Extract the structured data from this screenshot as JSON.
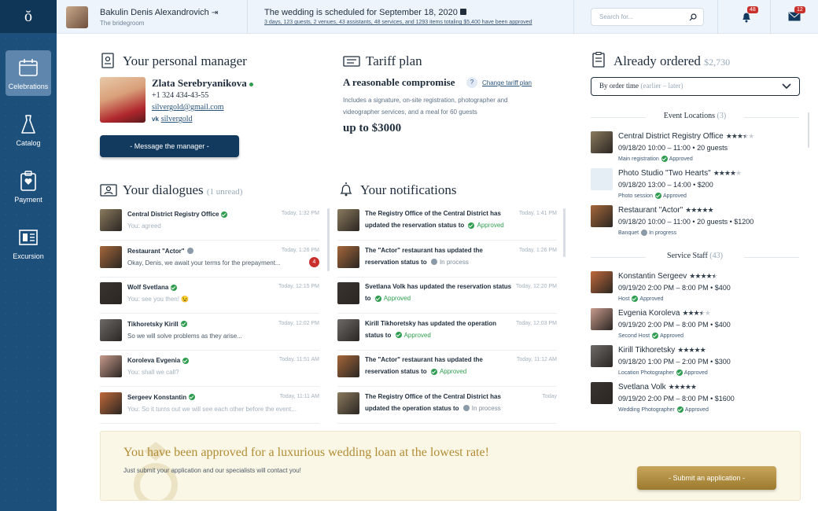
{
  "sidebar": {
    "logo": "ŏ",
    "items": [
      {
        "label": "Celebrations",
        "active": true
      },
      {
        "label": "Catalog"
      },
      {
        "label": "Payment"
      },
      {
        "label": "Excursion"
      }
    ]
  },
  "topbar": {
    "user_name": "Bakulin Denis Alexandrovich",
    "user_role": "The bridegroom",
    "wedding_title": "The wedding is scheduled for September 18, 2020",
    "wedding_summary": "3 days, 123 guests, 2 venues, 43 assistants, 48 services, and 1293 items totaling $5,400 have been approved",
    "search_placeholder": "Search for...",
    "notifications_count": "48",
    "messages_count": "12"
  },
  "manager": {
    "title": "Your personal manager",
    "name": "Zlata Serebryanikova",
    "phone": "+1 324 434-43-55",
    "email": "silvergold@gmail.com",
    "vk": "silvergold",
    "button": "- Message the manager  -"
  },
  "tariff": {
    "title": "Tariff plan",
    "name": "A reasonable compromise",
    "help": "?",
    "change": "Change tariff plan",
    "desc": "Includes a signature, on-site registration, photographer and videographer services, and a meal for 60 guests",
    "price": "up to $3000"
  },
  "dialogues": {
    "title": "Your dialogues",
    "unread": "(1 unread)",
    "items": [
      {
        "name": "Central District Registry Office",
        "msg": "You: agreed",
        "time": "Today, 1:32 PM",
        "verified": true,
        "reply": true,
        "thumb": "#8b7a5e"
      },
      {
        "name": "Restaurant \"Actor\"",
        "msg": "Okay, Denis, we await your terms for the prepayment...",
        "time": "Today, 1:26 PM",
        "verified": false,
        "reply": false,
        "unread": "4",
        "thumb": "#a5673a"
      },
      {
        "name": "Wolf Svetlana",
        "msg": "You: see you then! 😉",
        "time": "Today, 12:15 PM",
        "verified": true,
        "reply": true,
        "thumb": "#3a3430"
      },
      {
        "name": "Tikhoretsky Kirill",
        "msg": "So we will solve problems as they arise...",
        "time": "Today, 12:02 PM",
        "verified": true,
        "reply": false,
        "thumb": "#6d6a68"
      },
      {
        "name": "Koroleva Evgenia",
        "msg": "You: shall we call?",
        "time": "Today, 11:51 AM",
        "verified": true,
        "reply": true,
        "thumb": "#c79a8c"
      },
      {
        "name": "Sergeev Konstantin",
        "msg": "You: So it turns out we will see each other before the event...",
        "time": "Today, 11:11 AM",
        "verified": true,
        "reply": true,
        "thumb": "#c0693a"
      }
    ]
  },
  "notifications": {
    "title": "Your notifications",
    "items": [
      {
        "text": "The Registry Office of the Central District has updated the reservation status to",
        "status": "Approved",
        "time": "Today, 1:41 PM",
        "ok": true,
        "thumb": "#8b7a5e"
      },
      {
        "text": "The \"Actor\" restaurant has updated the reservation status to",
        "status": "In process",
        "time": "Today, 1:26 PM",
        "ok": false,
        "thumb": "#a5673a"
      },
      {
        "text": "Svetlana Volk has updated the reservation status to",
        "status": "Approved",
        "time": "Today, 12:20 PM",
        "ok": true,
        "thumb": "#3a3430"
      },
      {
        "text": "Kirill Tikhoretsky has updated the operation status to",
        "status": "Approved",
        "time": "Today, 12:03 PM",
        "ok": true,
        "thumb": "#6d6a68"
      },
      {
        "text": "The \"Actor\" restaurant has updated the reservation status to",
        "status": "Approved",
        "time": "Today, 11:12 AM",
        "ok": true,
        "thumb": "#a5673a"
      },
      {
        "text": "The Registry Office of the Central District has updated the operation status to",
        "status": "In process",
        "time": "Today",
        "ok": false,
        "thumb": "#8b7a5e"
      }
    ]
  },
  "ordered": {
    "title": "Already ordered",
    "total": "$2,730",
    "sort_label": "By order time",
    "sort_hint": "(earlier – later)",
    "groups": [
      {
        "name": "Event Locations",
        "count": "(3)",
        "items": [
          {
            "name": "Central District Registry Office",
            "stars": 3.5,
            "details": "09/18/20 10:00 – 11:00  •  20 guests",
            "role": "Main registration",
            "status": "Approved",
            "ok": true,
            "thumb": "#8b7a5e"
          },
          {
            "name": "Photo Studio \"Two Hearts\"",
            "stars": 4,
            "details": "09/18/20 13:00 – 14:00  •  $200",
            "role": "Photo session",
            "status": "Approved",
            "ok": true,
            "thumb": "#e5edf5"
          },
          {
            "name": "Restaurant \"Actor\"",
            "stars": 5,
            "details": "09/18/20 10:00 – 11:00  •  20 guests  •  $1200",
            "role": "Banquet",
            "status": "In progress",
            "ok": false,
            "thumb": "#a5673a"
          }
        ]
      },
      {
        "name": "Service Staff",
        "count": "(43)",
        "items": [
          {
            "name": "Konstantin Sergeev",
            "stars": 4.5,
            "details": "09/19/20 2:00 PM – 8:00 PM  •  $400",
            "role": "Host",
            "status": "Approved",
            "ok": true,
            "thumb": "#c0693a"
          },
          {
            "name": "Evgenia Koroleva",
            "stars": 3.5,
            "details": "09/19/20 2:00 PM – 8:00 PM  •  $400",
            "role": "Second Host",
            "status": "Approved",
            "ok": true,
            "thumb": "#c79a8c"
          },
          {
            "name": "Kirill Tikhoretsky",
            "stars": 5,
            "details": "09/18/20 1:00 PM – 2:00 PM  •  $300",
            "role": "Location Photographer",
            "status": "Approved",
            "ok": true,
            "thumb": "#6d6a68"
          },
          {
            "name": "Svetlana Volk",
            "stars": 5,
            "details": "09/19/20 2:00 PM – 8:00 PM  •  $1600",
            "role": "Wedding Photographer",
            "status": "Approved",
            "ok": true,
            "thumb": "#3a3430"
          }
        ]
      }
    ]
  },
  "banner": {
    "title": "You have been approved for a luxurious wedding loan at the lowest rate!",
    "sub": "Just submit your application and our specialists will contact you!",
    "button": "- Submit an application -"
  }
}
